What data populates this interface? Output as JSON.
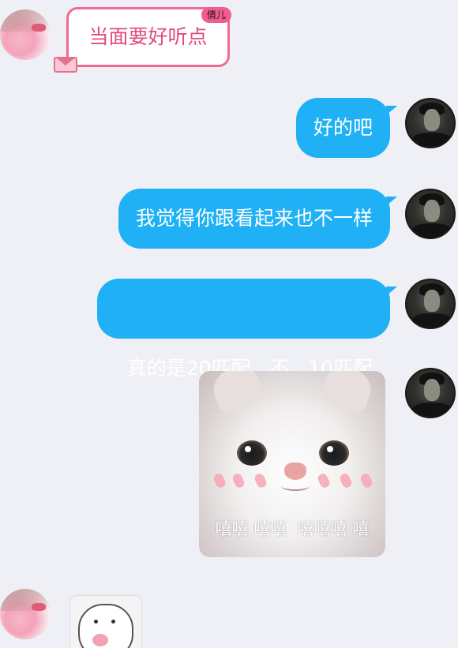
{
  "messages": [
    {
      "side": "left",
      "type": "text",
      "text": "当面要好听点",
      "tag": "倩儿"
    },
    {
      "side": "right",
      "type": "text",
      "text": "好的吧"
    },
    {
      "side": "right",
      "type": "text",
      "text": "我觉得你跟看起来也不一样"
    },
    {
      "side": "right",
      "type": "text",
      "text": "真的是20匹配   不   10匹配"
    },
    {
      "side": "right",
      "type": "sticker",
      "caption": "嘻嘻 嘻嘻  嘻嘻嘻 嘻"
    },
    {
      "side": "left",
      "type": "sticker",
      "caption": ""
    }
  ],
  "colors": {
    "background": "#eef0f6",
    "outgoing_bubble": "#1fb0f5",
    "incoming_border": "#f06a93",
    "incoming_text": "#e24c7a",
    "tag_bg": "#f25c8f"
  },
  "icons": {
    "envelope": "envelope-icon"
  }
}
